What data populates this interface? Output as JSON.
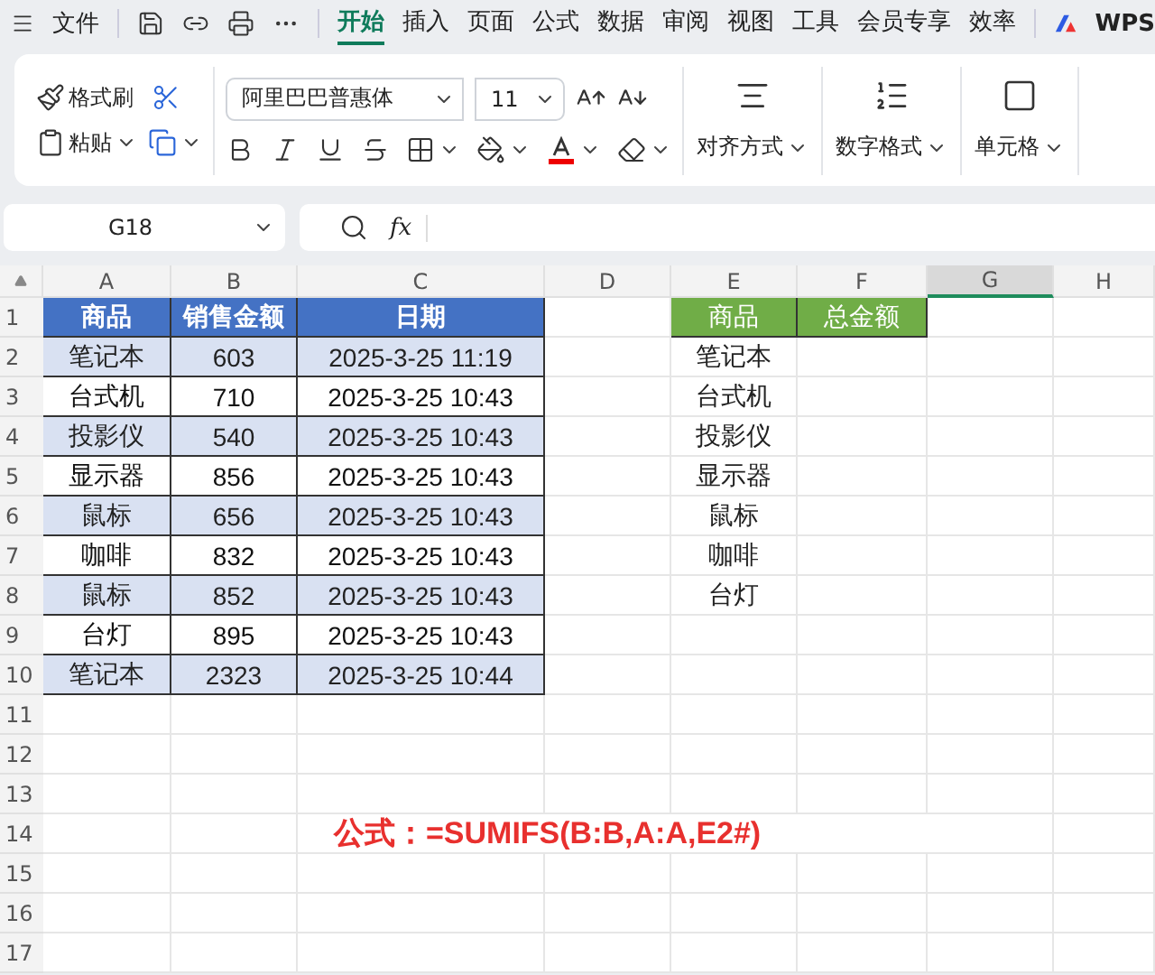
{
  "topbar": {
    "file_menu": "文件",
    "tabs": [
      {
        "label": "开始",
        "selected": true
      },
      {
        "label": "插入",
        "selected": false
      },
      {
        "label": "页面",
        "selected": false
      },
      {
        "label": "公式",
        "selected": false
      },
      {
        "label": "数据",
        "selected": false
      },
      {
        "label": "审阅",
        "selected": false
      },
      {
        "label": "视图",
        "selected": false
      },
      {
        "label": "工具",
        "selected": false
      },
      {
        "label": "会员专享",
        "selected": false
      },
      {
        "label": "效率",
        "selected": false
      }
    ],
    "brand": "WPS"
  },
  "ribbon": {
    "format_painter": "格式刷",
    "paste": "粘贴",
    "font_name": "阿里巴巴普惠体",
    "font_size": "11",
    "big_buttons": [
      {
        "kind": "align",
        "label": "对齐方式"
      },
      {
        "kind": "number",
        "label": "数字格式"
      },
      {
        "kind": "cells",
        "label": "单元格"
      }
    ]
  },
  "formula_bar": {
    "name_box": "G18",
    "fx": "fx"
  },
  "sheet": {
    "columns": [
      {
        "label": "A",
        "selected": false
      },
      {
        "label": "B",
        "selected": false
      },
      {
        "label": "C",
        "selected": false
      },
      {
        "label": "D",
        "selected": false
      },
      {
        "label": "E",
        "selected": false
      },
      {
        "label": "F",
        "selected": false
      },
      {
        "label": "G",
        "selected": true
      },
      {
        "label": "H",
        "selected": false
      }
    ],
    "rows": [
      {
        "label": "1",
        "cells": [
          {
            "text": "商品",
            "kind": "head1"
          },
          {
            "text": "销售金额",
            "kind": "head1"
          },
          {
            "text": "日期",
            "kind": "head1"
          },
          null,
          {
            "text": "商品",
            "kind": "head2"
          },
          {
            "text": "总金额",
            "kind": "head2"
          },
          null,
          null
        ]
      },
      {
        "label": "2",
        "cells": [
          {
            "text": "笔记本",
            "kind": "band"
          },
          {
            "text": "603",
            "kind": "band"
          },
          {
            "text": "2025-3-25 11:19",
            "kind": "band"
          },
          null,
          {
            "text": "笔记本",
            "kind": "loose"
          },
          null,
          null,
          null
        ]
      },
      {
        "label": "3",
        "cells": [
          {
            "text": "台式机",
            "kind": "row"
          },
          {
            "text": "710",
            "kind": "row"
          },
          {
            "text": "2025-3-25 10:43",
            "kind": "row"
          },
          null,
          {
            "text": "台式机",
            "kind": "loose"
          },
          null,
          null,
          null
        ]
      },
      {
        "label": "4",
        "cells": [
          {
            "text": "投影仪",
            "kind": "band"
          },
          {
            "text": "540",
            "kind": "band"
          },
          {
            "text": "2025-3-25 10:43",
            "kind": "band"
          },
          null,
          {
            "text": "投影仪",
            "kind": "loose"
          },
          null,
          null,
          null
        ]
      },
      {
        "label": "5",
        "cells": [
          {
            "text": "显示器",
            "kind": "row"
          },
          {
            "text": "856",
            "kind": "row"
          },
          {
            "text": "2025-3-25 10:43",
            "kind": "row"
          },
          null,
          {
            "text": "显示器",
            "kind": "loose"
          },
          null,
          null,
          null
        ]
      },
      {
        "label": "6",
        "cells": [
          {
            "text": "鼠标",
            "kind": "band"
          },
          {
            "text": "656",
            "kind": "band"
          },
          {
            "text": "2025-3-25 10:43",
            "kind": "band"
          },
          null,
          {
            "text": "鼠标",
            "kind": "loose"
          },
          null,
          null,
          null
        ]
      },
      {
        "label": "7",
        "cells": [
          {
            "text": "咖啡",
            "kind": "row"
          },
          {
            "text": "832",
            "kind": "row"
          },
          {
            "text": "2025-3-25 10:43",
            "kind": "row"
          },
          null,
          {
            "text": "咖啡",
            "kind": "loose"
          },
          null,
          null,
          null
        ]
      },
      {
        "label": "8",
        "cells": [
          {
            "text": "鼠标",
            "kind": "band"
          },
          {
            "text": "852",
            "kind": "band"
          },
          {
            "text": "2025-3-25 10:43",
            "kind": "band"
          },
          null,
          {
            "text": "台灯",
            "kind": "loose"
          },
          null,
          null,
          null
        ]
      },
      {
        "label": "9",
        "cells": [
          {
            "text": "台灯",
            "kind": "row"
          },
          {
            "text": "895",
            "kind": "row"
          },
          {
            "text": "2025-3-25 10:43",
            "kind": "row"
          },
          null,
          null,
          null,
          null,
          null
        ]
      },
      {
        "label": "10",
        "cells": [
          {
            "text": "笔记本",
            "kind": "band"
          },
          {
            "text": "2323",
            "kind": "band"
          },
          {
            "text": "2025-3-25 10:44",
            "kind": "band"
          },
          null,
          null,
          null,
          null,
          null
        ]
      },
      {
        "label": "11",
        "cells": [
          null,
          null,
          null,
          null,
          null,
          null,
          null,
          null
        ]
      },
      {
        "label": "12",
        "cells": [
          null,
          null,
          null,
          null,
          null,
          null,
          null,
          null
        ]
      },
      {
        "label": "13",
        "cells": [
          null,
          null,
          null,
          null,
          null,
          null,
          null,
          null
        ]
      },
      {
        "label": "14",
        "cells": [
          null,
          null,
          {
            "text": "公式：=SUMIFS(B:B,A:A,E2#)",
            "kind": "note"
          },
          null,
          null
        ]
      },
      {
        "label": "15",
        "cells": [
          null,
          null,
          null,
          null,
          null,
          null,
          null,
          null
        ]
      },
      {
        "label": "16",
        "cells": [
          null,
          null,
          null,
          null,
          null,
          null,
          null,
          null
        ]
      },
      {
        "label": "17",
        "cells": [
          null,
          null,
          null,
          null,
          null,
          null,
          null,
          null
        ]
      }
    ]
  }
}
